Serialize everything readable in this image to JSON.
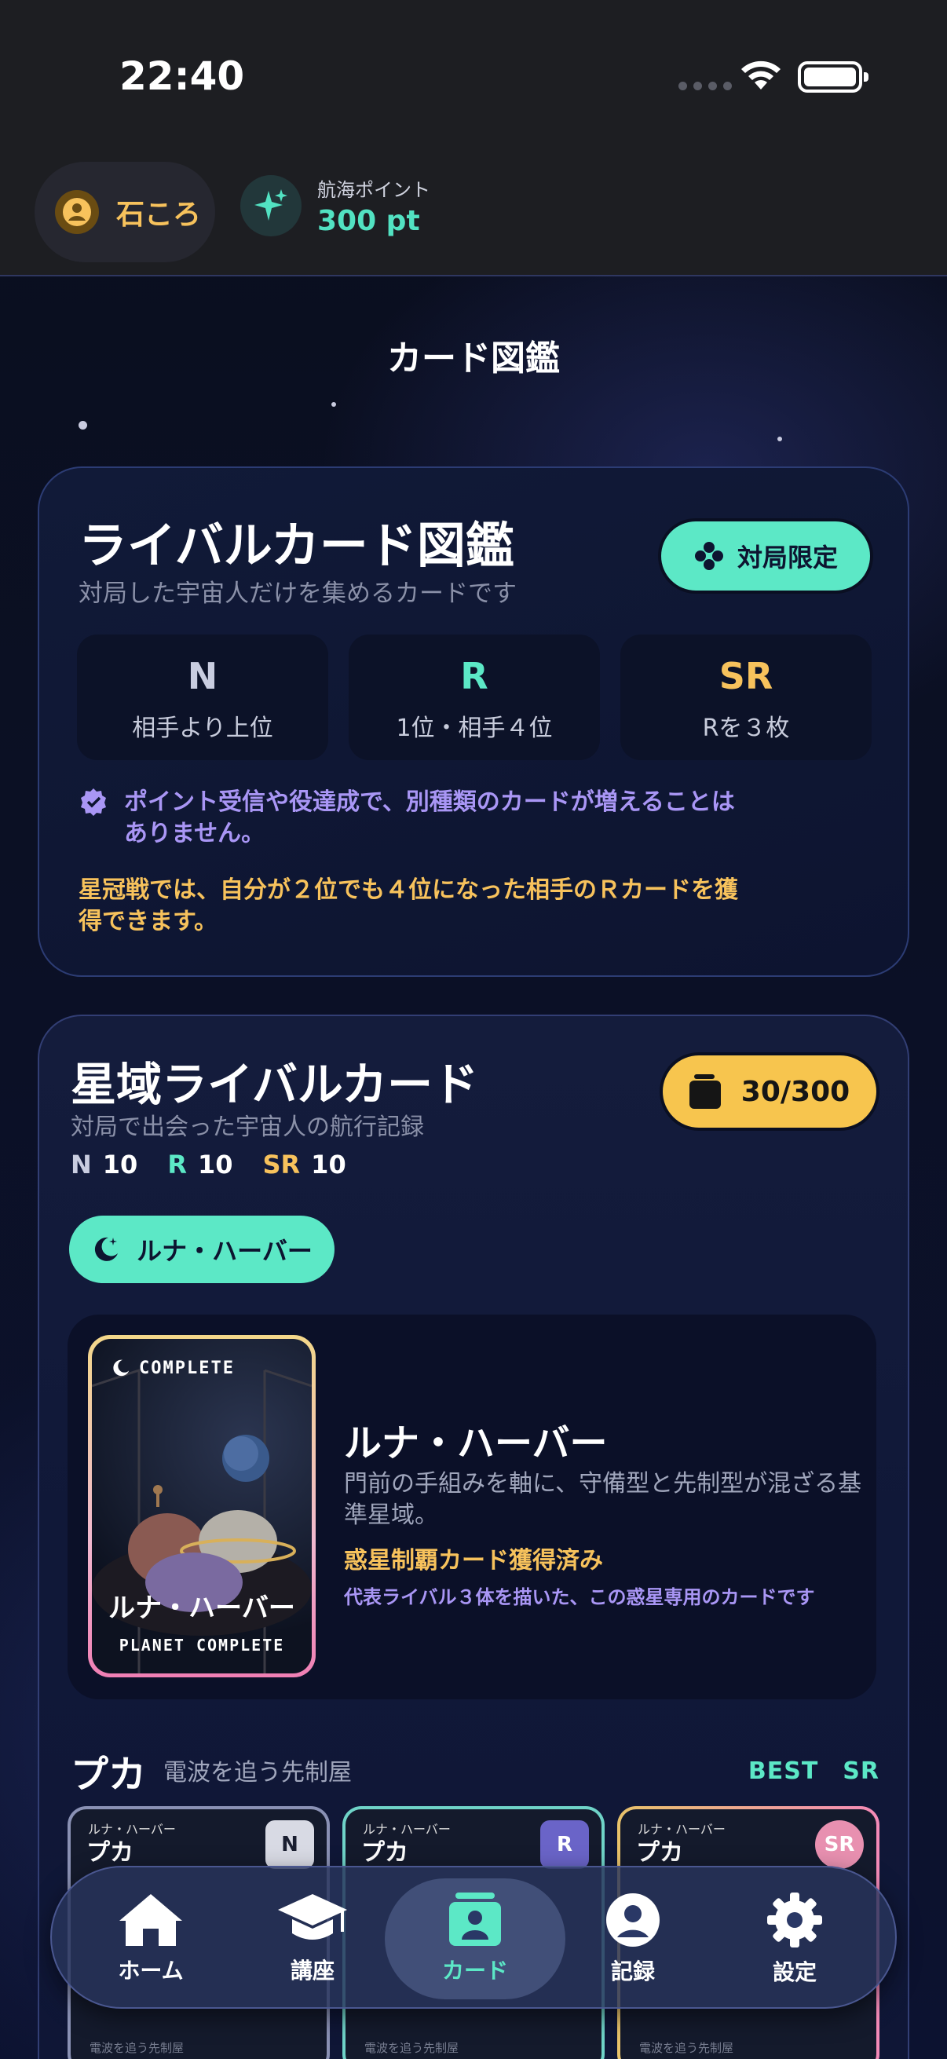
{
  "status_bar": {
    "time": "22:40"
  },
  "header": {
    "user_name": "石ころ",
    "points_label": "航海ポイント",
    "points_value": "300 pt"
  },
  "page_title": "カード図鑑",
  "rival_index": {
    "title": "ライバルカード図鑑",
    "subtitle": "対局した宇宙人だけを集めるカードです",
    "limited_button": "対局限定",
    "tiers": [
      {
        "tier": "N",
        "desc": "相手より上位",
        "color": "#c9cde0"
      },
      {
        "tier": "R",
        "desc": "1位・相手４位",
        "color": "#5ce8c6"
      },
      {
        "tier": "SR",
        "desc": "Rを３枚",
        "color": "#f7c25c"
      }
    ],
    "notice": "ポイント受信や役達成で、別種類のカードが増えることはありません。",
    "gold_note": "星冠戦では、自分が２位でも４位になった相手のＲカードを獲得できます。"
  },
  "sector": {
    "title": "星域ライバルカード",
    "subtitle": "対局で出会った宇宙人の航行記録",
    "count": "30/300",
    "counts": [
      {
        "label": "N",
        "value": "10",
        "color": "#c9cde0"
      },
      {
        "label": "R",
        "value": "10",
        "color": "#5ce8c6"
      },
      {
        "label": "SR",
        "value": "10",
        "color": "#f7c25c"
      }
    ],
    "planet_chip": "ルナ・ハーバー",
    "planet": {
      "card_complete": "COMPLETE",
      "card_name": "ルナ・ハーバー",
      "card_sub": "PLANET COMPLETE",
      "title": "ルナ・ハーバー",
      "desc": "門前の手組みを軸に、守備型と先制型が混ざる基準星域。",
      "gold": "惑星制覇カード獲得済み",
      "purple": "代表ライバル３体を描いた、この惑星専用のカードです"
    },
    "rival": {
      "name": "プカ",
      "role": "電波を追う先制屋",
      "best": "BEST　SR",
      "cards": [
        {
          "planet": "ルナ・ハーバー",
          "name": "プカ",
          "badge": "N",
          "foot": "電波を追う先制屋"
        },
        {
          "planet": "ルナ・ハーバー",
          "name": "プカ",
          "badge": "R",
          "foot": "電波を追う先制屋"
        },
        {
          "planet": "ルナ・ハーバー",
          "name": "プカ",
          "badge": "SR",
          "foot": "電波を追う先制屋"
        }
      ]
    }
  },
  "tabbar": {
    "home": "ホーム",
    "course": "講座",
    "card": "カード",
    "record": "記録",
    "settings": "設定"
  }
}
